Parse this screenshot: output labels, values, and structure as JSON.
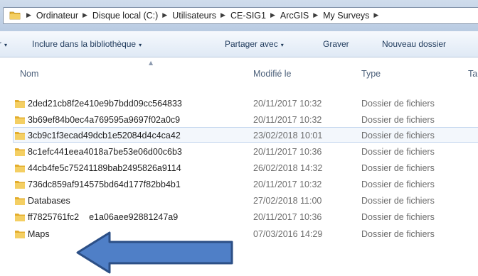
{
  "address_bar": {
    "crumbs": [
      "Ordinateur",
      "Disque local (C:)",
      "Utilisateurs",
      "CE-SIG1",
      "ArcGIS",
      "My Surveys"
    ]
  },
  "toolbar": {
    "first_caret": "▾",
    "include_library": "Inclure dans la bibliothèque",
    "share_with": "Partager avec",
    "burn": "Graver",
    "new_folder": "Nouveau dossier"
  },
  "columns": {
    "name": "Nom",
    "modified": "Modifié le",
    "type": "Type",
    "size_partial": "Ta"
  },
  "rows": [
    {
      "name": "2ded21cb8f2e410e9b7bdd09cc564833",
      "modified": "20/11/2017 10:32",
      "type": "Dossier de fichiers"
    },
    {
      "name": "3b69ef84b0ec4a769595a9697f02a0c9",
      "modified": "20/11/2017 10:32",
      "type": "Dossier de fichiers"
    },
    {
      "name": "3cb9c1f3ecad49dcb1e52084d4c4ca42",
      "modified": "23/02/2018 10:01",
      "type": "Dossier de fichiers"
    },
    {
      "name": "8c1efc441eea4018a7be53e06d00c6b3",
      "modified": "20/11/2017 10:36",
      "type": "Dossier de fichiers"
    },
    {
      "name": "44cb4fe5c75241189bab2495826a9114",
      "modified": "26/02/2018 14:32",
      "type": "Dossier de fichiers"
    },
    {
      "name": "736dc859af914575bd64d177f82bb4b1",
      "modified": "20/11/2017 10:32",
      "type": "Dossier de fichiers"
    },
    {
      "name": "Databases",
      "modified": "27/02/2018 11:00",
      "type": "Dossier de fichiers"
    },
    {
      "name": "ff7825761fc2",
      "name_tail": "e1a06aee92881247a9",
      "modified": "20/11/2017 10:36",
      "type": "Dossier de fichiers"
    },
    {
      "name": "Maps",
      "modified": "07/03/2016 14:29",
      "type": "Dossier de fichiers"
    }
  ],
  "selected_row": "3cb9c1f3ecad49dcb1e52084d4c4ca42",
  "colors": {
    "arrow_fill": "#4f7fc7",
    "arrow_stroke": "#2c4f86",
    "folder": "#e8b83c",
    "selection": "#f3f7fc"
  },
  "icons": {
    "folder": "folder-icon",
    "breadcrumb_separator": "chevron-right-icon",
    "annotation": "arrow-left-icon"
  }
}
